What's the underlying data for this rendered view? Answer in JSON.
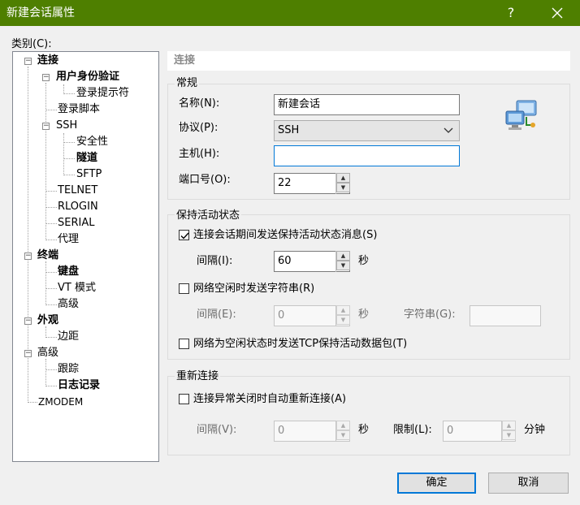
{
  "window": {
    "title": "新建会话属性",
    "help": "?",
    "close_icon": "close-icon"
  },
  "category_label": "类别(C):",
  "tree": [
    {
      "label": "连接",
      "bold": true
    },
    {
      "label": "用户身份验证",
      "bold": true
    },
    {
      "label": "登录提示符",
      "bold": false
    },
    {
      "label": "登录脚本",
      "bold": false
    },
    {
      "label": "SSH",
      "bold": false
    },
    {
      "label": "安全性",
      "bold": false
    },
    {
      "label": "隧道",
      "bold": true
    },
    {
      "label": "SFTP",
      "bold": false
    },
    {
      "label": "TELNET",
      "bold": false
    },
    {
      "label": "RLOGIN",
      "bold": false
    },
    {
      "label": "SERIAL",
      "bold": false
    },
    {
      "label": "代理",
      "bold": false
    },
    {
      "label": "终端",
      "bold": true
    },
    {
      "label": "键盘",
      "bold": true
    },
    {
      "label": "VT 模式",
      "bold": false
    },
    {
      "label": "高级",
      "bold": false
    },
    {
      "label": "外观",
      "bold": true
    },
    {
      "label": "边距",
      "bold": false
    },
    {
      "label": "高级",
      "bold": false
    },
    {
      "label": "跟踪",
      "bold": false
    },
    {
      "label": "日志记录",
      "bold": true
    },
    {
      "label": "ZMODEM",
      "bold": false
    }
  ],
  "panel_title": "连接",
  "general": {
    "title": "常规",
    "name_label": "名称(N):",
    "name_value": "新建会话",
    "protocol_label": "协议(P):",
    "protocol_value": "SSH",
    "host_label": "主机(H):",
    "host_value": "",
    "port_label": "端口号(O):",
    "port_value": "22"
  },
  "keepalive": {
    "title": "保持活动状态",
    "send_msg_label": "连接会话期间发送保持活动状态消息(S)",
    "send_msg_checked": true,
    "interval1_label": "间隔(I):",
    "interval1_value": "60",
    "interval1_unit": "秒",
    "send_str_label": "网络空闲时发送字符串(R)",
    "send_str_checked": false,
    "interval2_label": "间隔(E):",
    "interval2_value": "0",
    "interval2_unit": "秒",
    "string_label": "字符串(G):",
    "string_value": "",
    "tcp_label": "网络为空闲状态时发送TCP保持活动数据包(T)",
    "tcp_checked": false
  },
  "reconnect": {
    "title": "重新连接",
    "auto_label": "连接异常关闭时自动重新连接(A)",
    "auto_checked": false,
    "interval_label": "间隔(V):",
    "interval_value": "0",
    "interval_unit": "秒",
    "limit_label": "限制(L):",
    "limit_value": "0",
    "limit_unit": "分钟"
  },
  "buttons": {
    "ok": "确定",
    "cancel": "取消"
  },
  "colors": {
    "titlebar": "#4e7f00",
    "focus": "#0078d7"
  }
}
